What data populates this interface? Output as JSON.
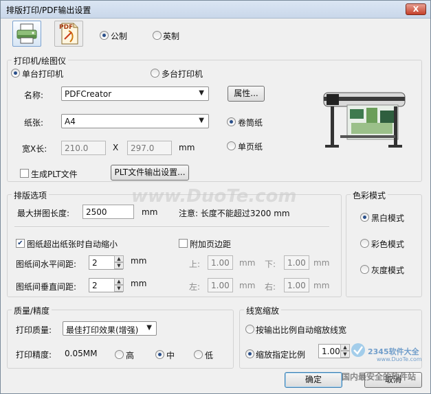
{
  "window": {
    "title": "排版打印/PDF输出设置",
    "close_label": "X"
  },
  "toolbar": {
    "printer_icon": "printer-icon",
    "pdf_icon": "pdf-icon",
    "pdf_icon_text": "PDF",
    "units": [
      {
        "label": "公制",
        "selected": true
      },
      {
        "label": "英制",
        "selected": false
      }
    ]
  },
  "printer_group": {
    "title": "打印机/绘图仪",
    "single_label": "单台打印机",
    "multi_label": "多台打印机",
    "name_label": "名称:",
    "name_value": "PDFCreator",
    "properties_button": "属性...",
    "paper_label": "纸张:",
    "paper_value": "A4",
    "roll_label": "卷筒纸",
    "sheet_label": "单页纸",
    "size_label": "宽X长:",
    "width_value": "210.0",
    "x_label": "X",
    "length_value": "297.0",
    "mm_unit": "mm",
    "plt_label": "生成PLT文件",
    "plt_button": "PLT文件输出设置...",
    "plotter_image": "plotter-image"
  },
  "layout_group": {
    "title": "排版选项",
    "max_len_label": "最大拼图长度:",
    "max_len_value": "2500",
    "mm_unit": "mm",
    "note": "注意: 长度不能超过3200 mm",
    "autoshrink_label": "图纸超出纸张时自动缩小",
    "margin_label": "附加页边距",
    "h_gap_label": "图纸间水平间距:",
    "h_gap_value": "2",
    "v_gap_label": "图纸间垂直间距:",
    "v_gap_value": "2",
    "top_label": "上:",
    "top_value": "1.00",
    "bottom_label": "下:",
    "bottom_value": "1.00",
    "left_label": "左:",
    "left_value": "1.00",
    "right_label": "右:",
    "right_value": "1.00"
  },
  "color_group": {
    "title": "色彩模式",
    "options": [
      {
        "label": "黑白模式",
        "selected": true
      },
      {
        "label": "彩色模式",
        "selected": false
      },
      {
        "label": "灰度模式",
        "selected": false
      }
    ]
  },
  "quality_group": {
    "title": "质量/精度",
    "quality_label": "打印质量:",
    "quality_value": "最佳打印效果(增强)",
    "precision_label": "打印精度:",
    "precision_value": "0.05MM",
    "precision_options": [
      {
        "label": "高",
        "selected": false
      },
      {
        "label": "中",
        "selected": true
      },
      {
        "label": "低",
        "selected": false
      }
    ]
  },
  "linewidth_group": {
    "title": "线宽缩放",
    "auto_label": "按输出比例自动缩放线宽",
    "specified_label": "缩放指定比例",
    "scale_value": "1.00"
  },
  "watermark": {
    "logo_text": "2345软件大全",
    "site_text": "www.DuoTe.com",
    "footer_text": "国内最安全的软件站",
    "big_text": "www.DuoTe.com"
  },
  "buttons": {
    "ok": "确定",
    "cancel": "取消"
  }
}
